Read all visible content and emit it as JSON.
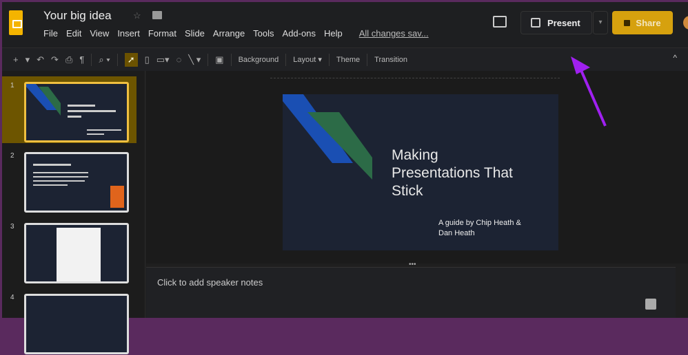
{
  "header": {
    "title": "Your big idea",
    "menu": [
      "File",
      "Edit",
      "View",
      "Insert",
      "Format",
      "Slide",
      "Arrange",
      "Tools",
      "Add-ons",
      "Help"
    ],
    "saved_status": "All changes sav...",
    "present_label": "Present",
    "share_label": "Share"
  },
  "toolbar": {
    "background": "Background",
    "layout": "Layout ▾",
    "theme": "Theme",
    "transition": "Transition"
  },
  "filmstrip": {
    "slides": [
      "1",
      "2",
      "3",
      "4"
    ]
  },
  "slide": {
    "title": "Making\nPresentations That\nStick",
    "subtitle": "A guide by Chip Heath &\nDan Heath"
  },
  "notes": {
    "placeholder": "Click to add speaker notes"
  },
  "colors": {
    "accent": "#d6a10e",
    "annotation_arrow": "#a020f0",
    "shape_blue": "#1a4fb3",
    "shape_green": "#2c6b47"
  }
}
